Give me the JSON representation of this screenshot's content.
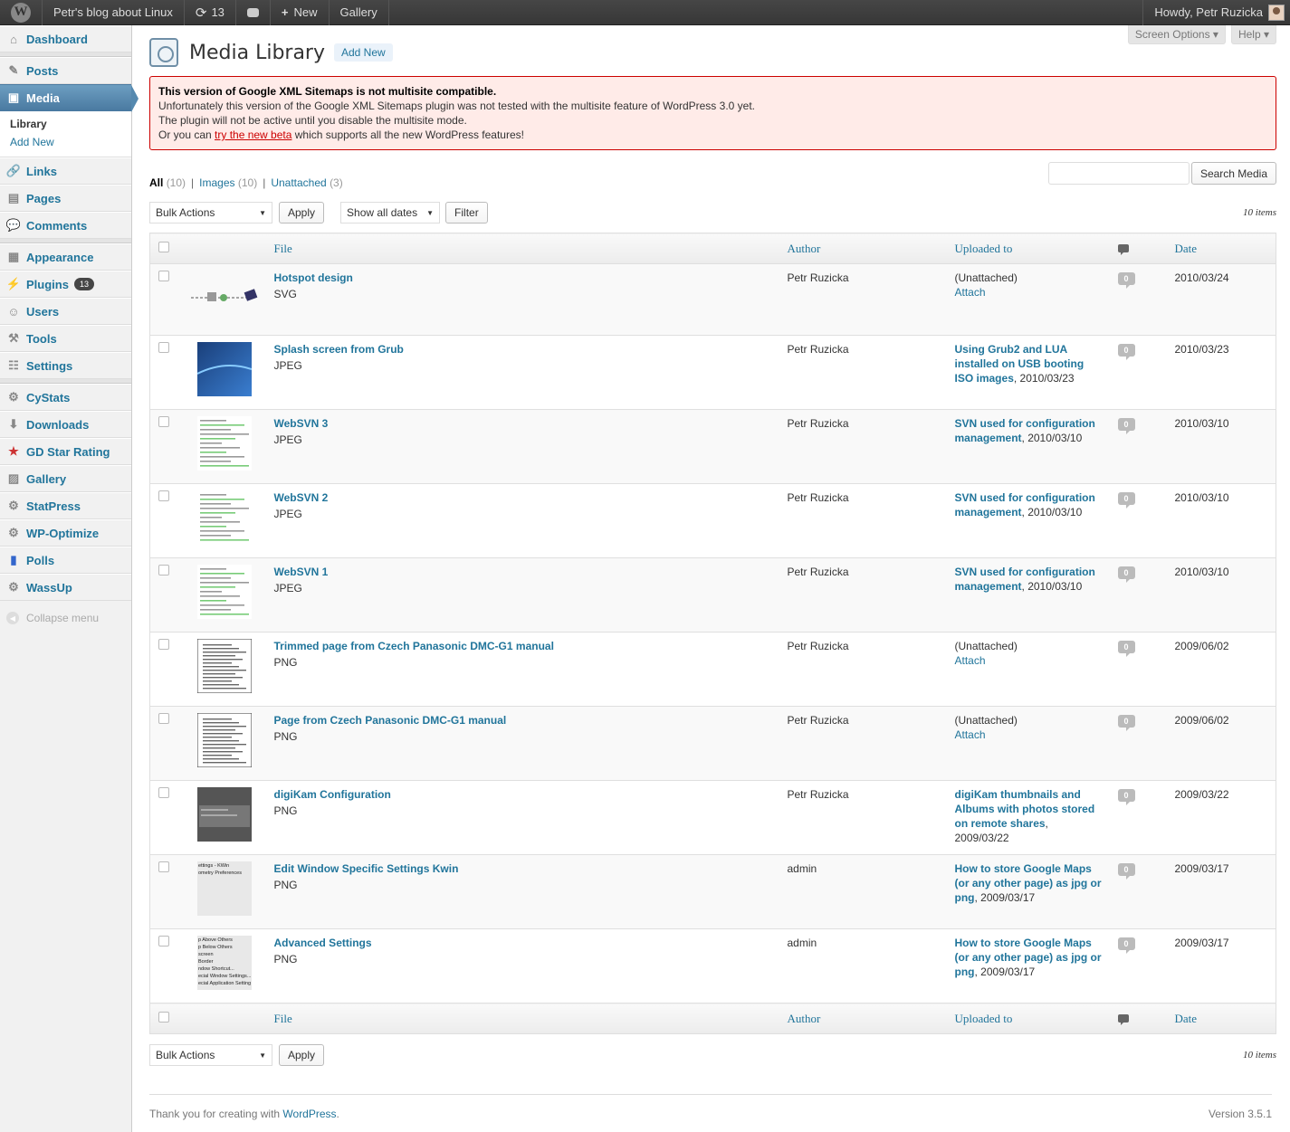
{
  "adminbar": {
    "site": "Petr's blog about Linux",
    "updates": "13",
    "new": "New",
    "gallery": "Gallery",
    "howdy": "Howdy, Petr Ruzicka"
  },
  "menu": {
    "dashboard": "Dashboard",
    "posts": "Posts",
    "media": "Media",
    "library": "Library",
    "add_new": "Add New",
    "links": "Links",
    "pages": "Pages",
    "comments": "Comments",
    "appearance": "Appearance",
    "plugins": "Plugins",
    "plugins_badge": "13",
    "users": "Users",
    "tools": "Tools",
    "settings": "Settings",
    "cystats": "CyStats",
    "downloads": "Downloads",
    "gdstar": "GD Star Rating",
    "gallery": "Gallery",
    "statpress": "StatPress",
    "wpoptimize": "WP-Optimize",
    "polls": "Polls",
    "wassup": "WassUp",
    "collapse": "Collapse menu"
  },
  "screen": {
    "options": "Screen Options ▾",
    "help": "Help ▾"
  },
  "page": {
    "title": "Media Library",
    "add_new": "Add New"
  },
  "notice": {
    "line1": "This version of Google XML Sitemaps is not multisite compatible.",
    "line2": "Unfortunately this version of the Google XML Sitemaps plugin was not tested with the multisite feature of WordPress 3.0 yet.",
    "line3": "The plugin will not be active until you disable the multisite mode.",
    "line4_pre": "Or you can ",
    "line4_link": "try the new beta",
    "line4_post": " which supports all the new WordPress features!"
  },
  "filters": {
    "all": "All",
    "all_count": "(10)",
    "images": "Images",
    "images_count": "(10)",
    "unattached": "Unattached",
    "unattached_count": "(3)"
  },
  "search": {
    "button": "Search Media",
    "value": ""
  },
  "nav": {
    "bulk": "Bulk Actions",
    "apply": "Apply",
    "dates": "Show all dates",
    "filter": "Filter",
    "items": "10 items"
  },
  "columns": {
    "file": "File",
    "author": "Author",
    "uploaded": "Uploaded to",
    "date": "Date"
  },
  "rows": [
    {
      "title": "Hotspot design",
      "type": "SVG",
      "author": "Petr Ruzicka",
      "up_link": "",
      "up_text": "(Unattached)",
      "attach": "Attach",
      "comments": "0",
      "date": "2010/03/24",
      "thumb": "svg"
    },
    {
      "title": "Splash screen from Grub",
      "type": "JPEG",
      "author": "Petr Ruzicka",
      "up_link": "Using Grub2 and LUA installed on USB booting ISO images",
      "up_text": ", 2010/03/23",
      "attach": "",
      "comments": "0",
      "date": "2010/03/23",
      "thumb": "blue"
    },
    {
      "title": "WebSVN 3",
      "type": "JPEG",
      "author": "Petr Ruzicka",
      "up_link": "SVN used for configuration management",
      "up_text": ", 2010/03/10",
      "attach": "",
      "comments": "0",
      "date": "2010/03/10",
      "thumb": "doc"
    },
    {
      "title": "WebSVN 2",
      "type": "JPEG",
      "author": "Petr Ruzicka",
      "up_link": "SVN used for configuration management",
      "up_text": ", 2010/03/10",
      "attach": "",
      "comments": "0",
      "date": "2010/03/10",
      "thumb": "doc"
    },
    {
      "title": "WebSVN 1",
      "type": "JPEG",
      "author": "Petr Ruzicka",
      "up_link": "SVN used for configuration management",
      "up_text": ", 2010/03/10",
      "attach": "",
      "comments": "0",
      "date": "2010/03/10",
      "thumb": "doc"
    },
    {
      "title": "Trimmed page from Czech Panasonic DMC-G1 manual",
      "type": "PNG",
      "author": "Petr Ruzicka",
      "up_link": "",
      "up_text": "(Unattached)",
      "attach": "Attach",
      "comments": "0",
      "date": "2009/06/02",
      "thumb": "page"
    },
    {
      "title": "Page from Czech Panasonic DMC-G1 manual",
      "type": "PNG",
      "author": "Petr Ruzicka",
      "up_link": "",
      "up_text": "(Unattached)",
      "attach": "Attach",
      "comments": "0",
      "date": "2009/06/02",
      "thumb": "page"
    },
    {
      "title": "digiKam Configuration",
      "type": "PNG",
      "author": "Petr Ruzicka",
      "up_link": "digiKam thumbnails and Albums with photos stored on remote shares",
      "up_text": ", 2009/03/22",
      "attach": "",
      "comments": "0",
      "date": "2009/03/22",
      "thumb": "dark"
    },
    {
      "title": "Edit Window Specific Settings Kwin",
      "type": "PNG",
      "author": "admin",
      "up_link": "How to store Google Maps (or any other page) as jpg or png",
      "up_text": ", 2009/03/17",
      "attach": "",
      "comments": "0",
      "date": "2009/03/17",
      "thumb": "kwin"
    },
    {
      "title": "Advanced Settings",
      "type": "PNG",
      "author": "admin",
      "up_link": "How to store Google Maps (or any other page) as jpg or png",
      "up_text": ", 2009/03/17",
      "attach": "",
      "comments": "0",
      "date": "2009/03/17",
      "thumb": "kwin2"
    }
  ],
  "thumb_texts": {
    "kwin": [
      "ettings - KWin",
      "ometry  Preferences"
    ],
    "kwin2": [
      "p Above Others",
      "p Below Others",
      "screen",
      "Border",
      "ndow Shortcut...",
      "ecial Window Settings...",
      "ecial Application Setting"
    ]
  },
  "footer": {
    "thanks": "Thank you for creating with ",
    "wp": "WordPress",
    "dot": ".",
    "version": "Version 3.5.1"
  }
}
